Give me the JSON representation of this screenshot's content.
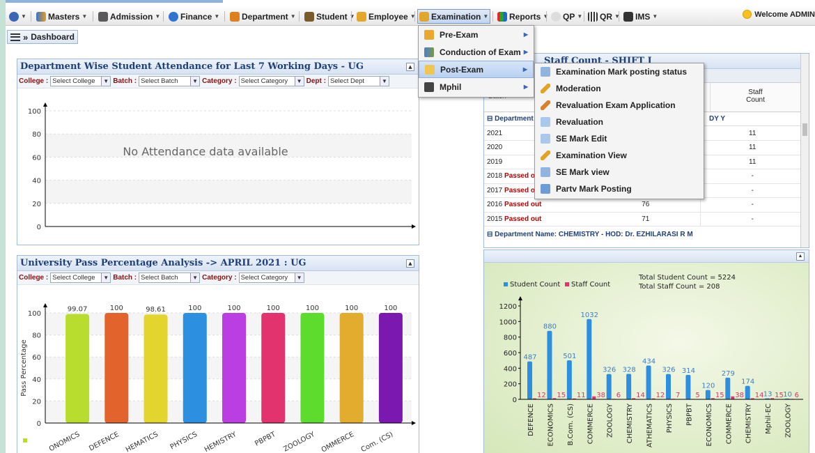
{
  "menu": {
    "items": [
      "Masters",
      "Admission",
      "Finance",
      "Department",
      "Student",
      "Employee",
      "Examination",
      "Reports",
      "QP",
      "QR",
      "IMS"
    ],
    "welcome": "Welcome ADMIN"
  },
  "subbar": {
    "dashboard_label": "Dashboard"
  },
  "exam_menu": {
    "items": [
      "Pre-Exam",
      "Conduction of Exam",
      "Post-Exam",
      "Mphil"
    ]
  },
  "post_exam_menu": {
    "items": [
      "Examination Mark posting status",
      "Moderation",
      "Revaluation Exam Application",
      "Revaluation",
      "SE Mark Edit",
      "Examination View",
      "SE Mark view",
      "Partv Mark Posting"
    ]
  },
  "attendance_panel": {
    "title": "Department Wise Student Attendance for Last 7 Working Days - UG",
    "college_label": "College :",
    "college_value": "Select College",
    "batch_label": "Batch :",
    "batch_value": "Select Batch",
    "category_label": "Category :",
    "category_value": "Select Category",
    "dept_label": "Dept :",
    "dept_value": "Select Dept",
    "no_data": "No Attendance data available"
  },
  "pass_panel": {
    "title": "University Pass Percentage Analysis -> APRIL 2021 : UG",
    "college_label": "College :",
    "college_value": "Select College",
    "batch_label": "Batch :",
    "batch_value": "Select Batch",
    "category_label": "Category :",
    "category_value": "Select Category"
  },
  "staff_panel": {
    "title": "Staff Count - SHIFT I",
    "col_batch": "Batch",
    "col_staff_line1": "Staff",
    "col_staff_line2": "Count",
    "dept_row_prefix": "Department",
    "dept_row_suffix": "DY Y",
    "rows": [
      {
        "batch": "2021",
        "passed": "",
        "students": "",
        "staff": "11"
      },
      {
        "batch": "2020",
        "passed": "",
        "students": "",
        "staff": "11"
      },
      {
        "batch": "2019",
        "passed": "",
        "students": "",
        "staff": "11"
      },
      {
        "batch": "2018",
        "passed": "Passed o",
        "students": "",
        "staff": "-"
      },
      {
        "batch": "2017",
        "passed": "Passed o",
        "students": "",
        "staff": "-"
      },
      {
        "batch": "2016",
        "passed": "Passed out",
        "students": "76",
        "staff": "-"
      },
      {
        "batch": "2015",
        "passed": "Passed out",
        "students": "71",
        "staff": "-"
      }
    ],
    "dept2": "Department Name: CHEMISTRY - HOD: Dr. EZHILARASI R M"
  },
  "chart_data": [
    {
      "type": "line",
      "categories": [],
      "values": [],
      "title": "",
      "ylim": [
        0,
        100
      ],
      "yticks": [
        0,
        20,
        40,
        60,
        80,
        100
      ],
      "grid": true
    },
    {
      "type": "bar",
      "ylabel": "Pass Percentage",
      "ylim": [
        0,
        100
      ],
      "yticks": [
        0,
        20,
        40,
        60,
        80,
        100
      ],
      "categories": [
        "ONOMICS",
        "DEFENCE",
        "HEMATICS",
        "PHYSICS",
        "HEMISTRY",
        "PBPBT",
        "ZOOLOGY",
        "OMMERCE",
        "Com. (CS)"
      ],
      "values": [
        99.07,
        100,
        98.61,
        100,
        100,
        100,
        100,
        100,
        100
      ],
      "value_labels": [
        "99.07",
        "100",
        "98.61",
        "100",
        "100",
        "100",
        "100",
        "100",
        "100"
      ],
      "colors": [
        "#b9dd2e",
        "#e2632c",
        "#e4d42e",
        "#2d8fe0",
        "#bb3ee3",
        "#e3336f",
        "#5ddc2d",
        "#e2ad2e",
        "#7a18b0"
      ]
    },
    {
      "type": "bar",
      "legend": [
        "Student Count",
        "Staff Count"
      ],
      "legend_colors": [
        "#2e8fe0",
        "#e3336f"
      ],
      "totals": [
        "Total Student Count = 5224",
        "Total Staff Count = 208"
      ],
      "ylim": [
        0,
        1200
      ],
      "yticks": [
        0,
        200,
        400,
        600,
        800,
        1000,
        1200
      ],
      "categories": [
        "DEFENCE",
        "ECONOMICS",
        "B.Com. (CS)",
        "COMMERCE",
        "ZOOLOGY",
        "CHEMISTRY",
        "ATHEMATICS",
        "PHYSICS",
        "PBPBT",
        "ECONOMICS",
        "COMMERCE",
        "CHEMISTRY",
        "Mphil-EC",
        "ZOOLOGY"
      ],
      "series": [
        {
          "name": "Student Count",
          "values": [
            487,
            880,
            501,
            1032,
            326,
            328,
            434,
            326,
            314,
            120,
            279,
            174,
            13,
            10
          ]
        },
        {
          "name": "Staff Count",
          "values": [
            12,
            15,
            11,
            38,
            6,
            14,
            12,
            7,
            5,
            15,
            38,
            14,
            15,
            6
          ]
        }
      ]
    }
  ]
}
